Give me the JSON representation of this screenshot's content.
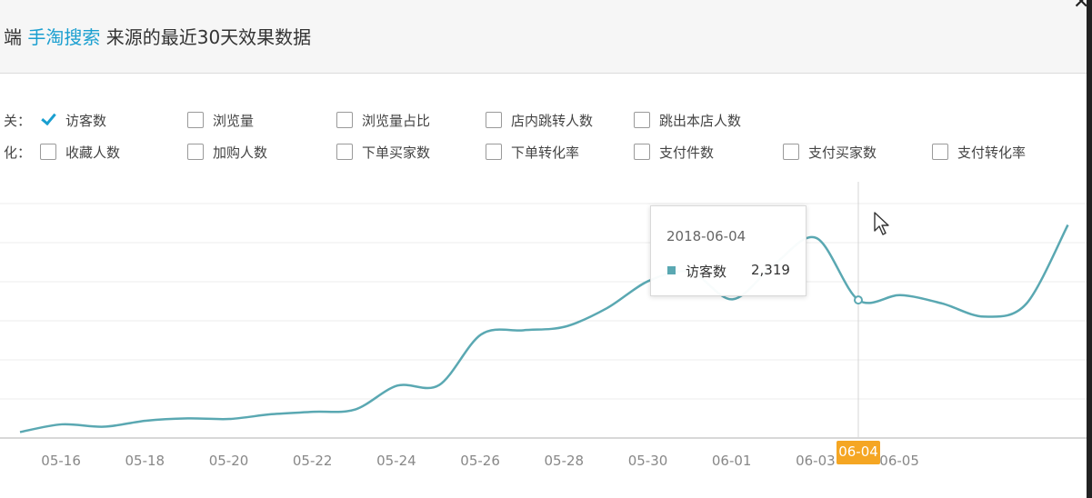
{
  "header": {
    "title_prefix": "端",
    "title_source": "手淘搜索",
    "title_suffix": "来源的最近30天效果数据"
  },
  "rows": [
    {
      "label": "关：",
      "options": [
        {
          "label": "访客数",
          "checked": true
        },
        {
          "label": "浏览量",
          "checked": false
        },
        {
          "label": "浏览量占比",
          "checked": false
        },
        {
          "label": "店内跳转人数",
          "checked": false
        },
        {
          "label": "跳出本店人数",
          "checked": false
        }
      ]
    },
    {
      "label": "化：",
      "options": [
        {
          "label": "收藏人数",
          "checked": false
        },
        {
          "label": "加购人数",
          "checked": false
        },
        {
          "label": "下单买家数",
          "checked": false
        },
        {
          "label": "下单转化率",
          "checked": false
        },
        {
          "label": "支付件数",
          "checked": false
        },
        {
          "label": "支付买家数",
          "checked": false
        },
        {
          "label": "支付转化率",
          "checked": false
        }
      ]
    }
  ],
  "tooltip": {
    "date": "2018-06-04",
    "series": "访客数",
    "value": "2,319"
  },
  "chart_data": {
    "type": "line",
    "x": [
      "05-15",
      "05-16",
      "05-17",
      "05-18",
      "05-19",
      "05-20",
      "05-21",
      "05-22",
      "05-23",
      "05-24",
      "05-25",
      "05-26",
      "05-27",
      "05-28",
      "05-29",
      "05-30",
      "05-31",
      "06-01",
      "06-02",
      "06-03",
      "06-04",
      "06-05",
      "06-06",
      "06-07",
      "06-08",
      "06-09"
    ],
    "series": [
      {
        "name": "访客数",
        "values": [
          100,
          230,
          190,
          290,
          330,
          320,
          400,
          440,
          480,
          880,
          890,
          1740,
          1810,
          1870,
          2180,
          2640,
          2790,
          2330,
          2920,
          3360,
          2319,
          2400,
          2260,
          2040,
          2250,
          3580
        ]
      }
    ],
    "tick_labels": [
      "05-16",
      "05-18",
      "05-20",
      "05-22",
      "05-24",
      "05-26",
      "05-28",
      "05-30",
      "06-01",
      "06-03",
      "06-04",
      "06-05"
    ],
    "highlight": "06-04",
    "ylim": [
      0,
      4000
    ],
    "grid": true,
    "colors": {
      "line": "#5aa8b2",
      "highlight_bg": "#f5a623",
      "axis": "#cccccc"
    }
  }
}
